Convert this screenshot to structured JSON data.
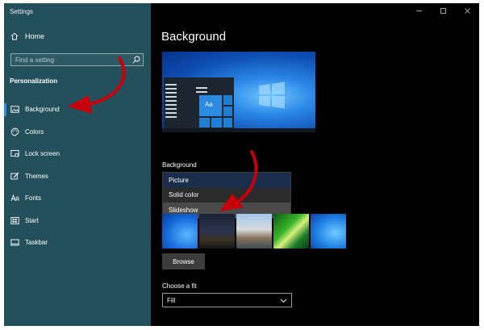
{
  "window": {
    "app_title": "Settings"
  },
  "sidebar": {
    "home_label": "Home",
    "search_placeholder": "Find a setting",
    "section_title": "Personalization",
    "items": [
      {
        "label": "Background",
        "icon": "picture-icon",
        "active": true
      },
      {
        "label": "Colors",
        "icon": "palette-icon",
        "active": false
      },
      {
        "label": "Lock screen",
        "icon": "lock-screen-icon",
        "active": false
      },
      {
        "label": "Themes",
        "icon": "brush-icon",
        "active": false
      },
      {
        "label": "Fonts",
        "icon": "font-icon",
        "active": false
      },
      {
        "label": "Start",
        "icon": "start-icon",
        "active": false
      },
      {
        "label": "Taskbar",
        "icon": "taskbar-icon",
        "active": false
      }
    ]
  },
  "main": {
    "page_title": "Background",
    "preview_tile_text": "Aa",
    "background_label": "Background",
    "dropdown_options": [
      {
        "label": "Picture",
        "state": "selected"
      },
      {
        "label": "Solid color",
        "state": "normal"
      },
      {
        "label": "Slideshow",
        "state": "hover"
      }
    ],
    "browse_label": "Browse",
    "fit_label": "Choose a fit",
    "fit_value": "Fill"
  },
  "colors": {
    "sidebar_bg": "#24505c",
    "accent": "#2f8ff0",
    "annotation_arrow": "#c8000b"
  }
}
